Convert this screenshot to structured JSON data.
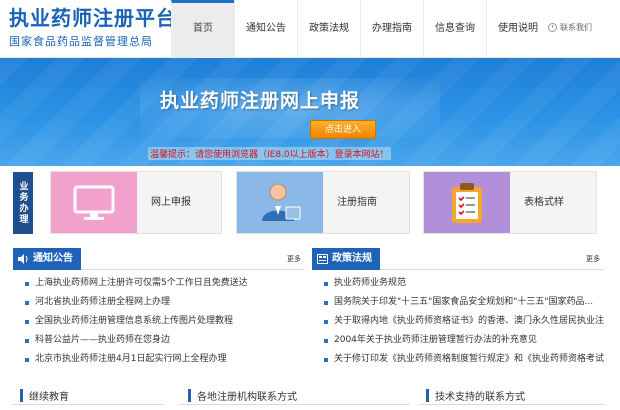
{
  "header": {
    "site_title": "执业药师注册平台",
    "site_subtitle": "国家食品药品监督管理总局",
    "nav": [
      {
        "label": "首页",
        "active": true
      },
      {
        "label": "通知公告",
        "active": false
      },
      {
        "label": "政策法规",
        "active": false
      },
      {
        "label": "办理指南",
        "active": false
      },
      {
        "label": "信息查询",
        "active": false
      },
      {
        "label": "使用说明",
        "active": false
      }
    ],
    "contact_label": "联系我们"
  },
  "banner": {
    "title": "执业药师注册网上申报",
    "enter_button": "点击进入",
    "warning": "温馨提示：请您使用浏览器（IE8.0以上版本）登录本网站！"
  },
  "business": {
    "label": "业务办理",
    "cards": [
      {
        "label": "网上申报",
        "icon": "monitor-icon",
        "color": "#f2a0cc"
      },
      {
        "label": "注册指南",
        "icon": "user-guide-icon",
        "color": "#8ab9e8"
      },
      {
        "label": "表格式样",
        "icon": "clipboard-icon",
        "color": "#b18fd9"
      }
    ]
  },
  "notices": {
    "title": "通知公告",
    "more": "更多",
    "items": [
      "上海执业药师网上注册许可仅需5个工作日且免费送达",
      "河北省执业药师注册全程网上办理",
      "全国执业药师注册管理信息系统上传图片处理教程",
      "科普公益片——执业药师在您身边",
      "北京市执业药师注册4月1日起实行网上全程办理"
    ]
  },
  "policies": {
    "title": "政策法规",
    "more": "更多",
    "items": [
      "执业药师业务规范",
      "国务院关于印发\"十三五\"国家食品安全规划和\"十三五\"国家药品...",
      "关于取得内地《执业药师资格证书》的香港、澳门永久性居民执业注...",
      "2004年关于执业药师注册管理暂行办法的补充意见",
      "关于修订印发《执业药师资格制度暂行规定》和《执业药师资格考试..."
    ]
  },
  "bottom": {
    "education": "继续教育",
    "agencies": "各地注册机构联系方式",
    "support": "技术支持的联系方式"
  }
}
